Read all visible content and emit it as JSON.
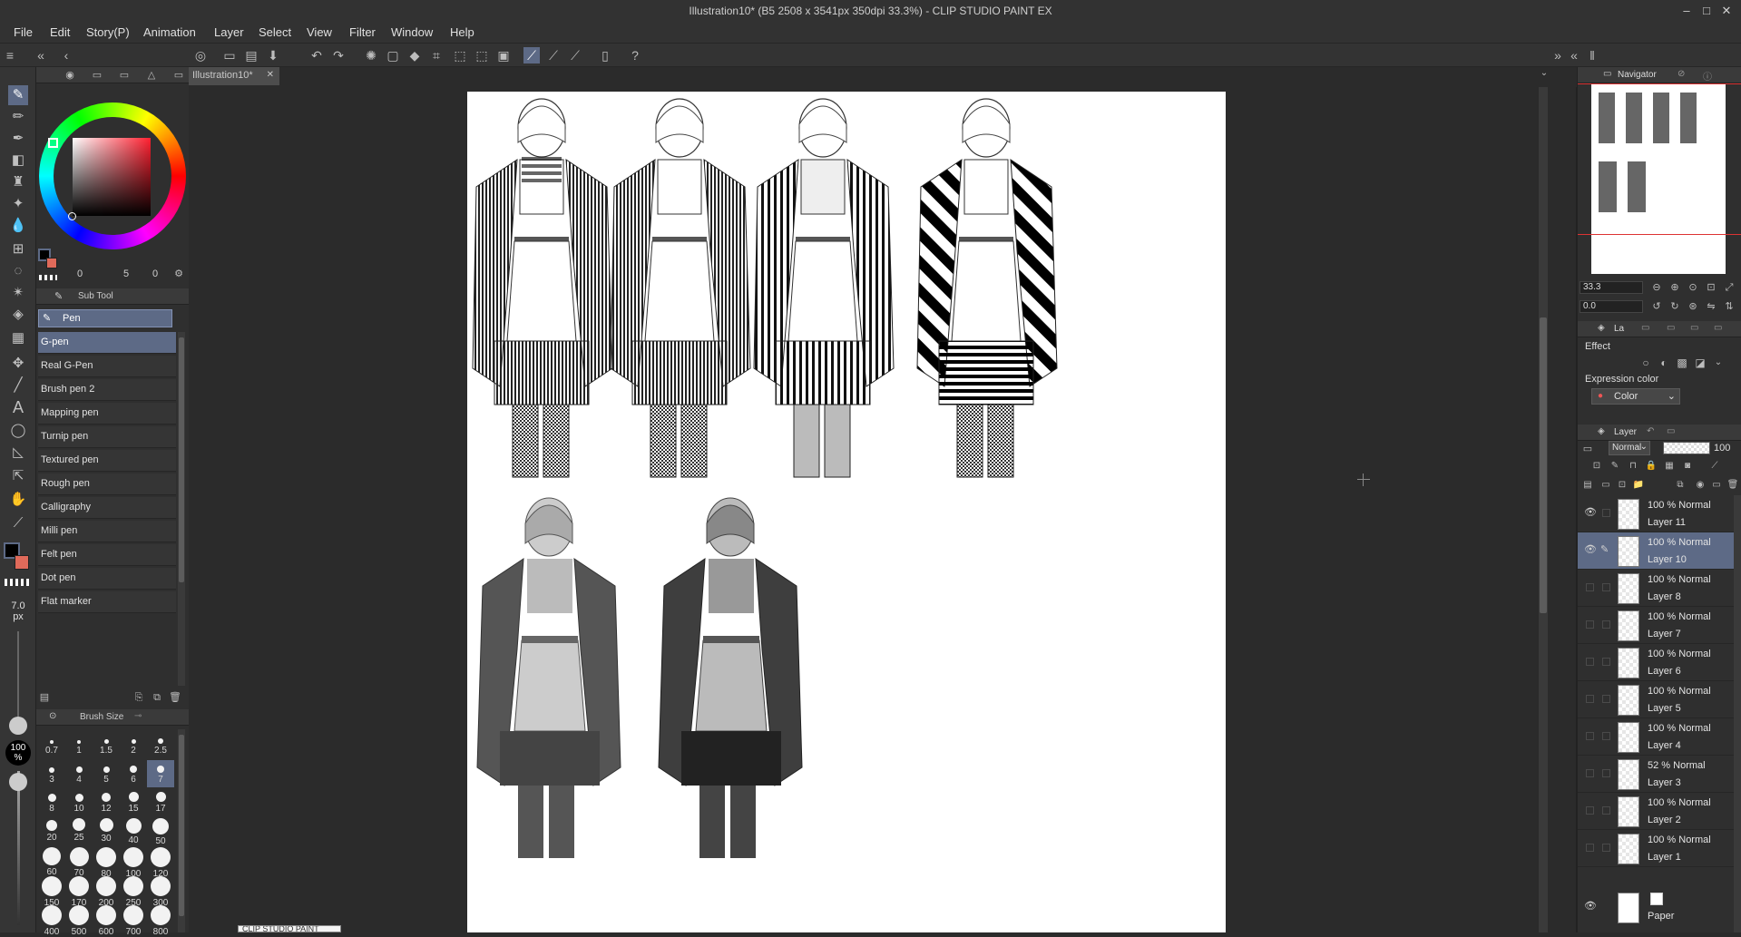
{
  "window": {
    "title": "Illustration10* (B5 2508 x 3541px 350dpi 33.3%)  - CLIP STUDIO PAINT EX"
  },
  "menu": [
    "File",
    "Edit",
    "Story(P)",
    "Animation",
    "Layer",
    "Select",
    "View",
    "Filter",
    "Window",
    "Help"
  ],
  "document_tab": {
    "label": "Illustration10*"
  },
  "color": {
    "main": "#000000",
    "sub": "#e06a5a",
    "accent": "#5d6a86",
    "values": [
      "0",
      "5",
      "0"
    ]
  },
  "subtool": {
    "header": "Sub Tool",
    "group": "Pen",
    "items": [
      "G-pen",
      "Real G-Pen",
      "Brush pen 2",
      "Mapping pen",
      "Turnip pen",
      "Textured pen",
      "Rough pen",
      "Calligraphy",
      "Milli pen",
      "Felt pen",
      "Dot pen",
      "Flat marker"
    ],
    "selected_index": 0
  },
  "brush": {
    "size_value": "7.0",
    "size_unit": "px",
    "opacity_value": "100",
    "opacity_unit": "%",
    "panel_title": "Brush Size",
    "sizes": [
      "0.7",
      "1",
      "1.5",
      "2",
      "2.5",
      "3",
      "4",
      "5",
      "6",
      "7",
      "8",
      "10",
      "12",
      "15",
      "17",
      "20",
      "25",
      "30",
      "40",
      "50",
      "60",
      "70",
      "80",
      "100",
      "120",
      "150",
      "170",
      "200",
      "250",
      "300",
      "400",
      "500",
      "600",
      "700",
      "800"
    ],
    "selected": "7"
  },
  "navigator": {
    "tab_label": "Navigator",
    "zoom": "33.3",
    "rotation": "0.0"
  },
  "layer_property": {
    "tab_label": "La",
    "effect_label": "Effect",
    "expression_label": "Expression color",
    "expression_value": "Color"
  },
  "layer_panel": {
    "tab_label": "Layer",
    "blend_mode": "Normal",
    "opacity": "100",
    "layers": [
      {
        "mode": "100 % Normal",
        "name": "Layer 11",
        "visible": true,
        "editing": false,
        "selected": false
      },
      {
        "mode": "100 % Normal",
        "name": "Layer 10",
        "visible": true,
        "editing": true,
        "selected": true
      },
      {
        "mode": "100 % Normal",
        "name": "Layer 8",
        "visible": false,
        "editing": false,
        "selected": false
      },
      {
        "mode": "100 % Normal",
        "name": "Layer 7",
        "visible": false,
        "editing": false,
        "selected": false
      },
      {
        "mode": "100 % Normal",
        "name": "Layer 6",
        "visible": false,
        "editing": false,
        "selected": false
      },
      {
        "mode": "100 % Normal",
        "name": "Layer 5",
        "visible": false,
        "editing": false,
        "selected": false
      },
      {
        "mode": "100 % Normal",
        "name": "Layer 4",
        "visible": false,
        "editing": false,
        "selected": false
      },
      {
        "mode": "52 % Normal",
        "name": "Layer 3",
        "visible": false,
        "editing": false,
        "selected": false
      },
      {
        "mode": "100 % Normal",
        "name": "Layer 2",
        "visible": false,
        "editing": false,
        "selected": false
      },
      {
        "mode": "100 % Normal",
        "name": "Layer 1",
        "visible": false,
        "editing": false,
        "selected": false
      }
    ],
    "paper": {
      "name": "Paper",
      "visible": true
    }
  },
  "footer_popup": "CLIP STUDIO PAINT"
}
